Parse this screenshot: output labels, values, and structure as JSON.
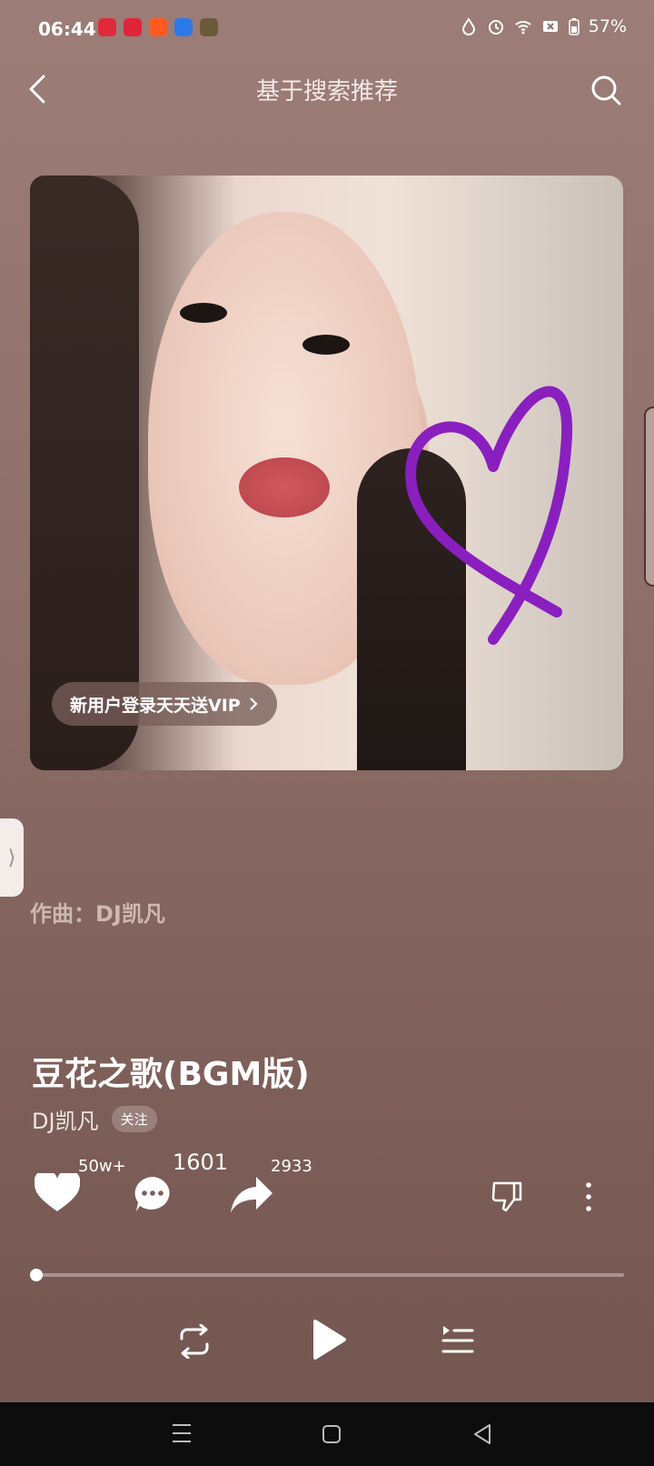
{
  "status_bar": {
    "time": "06:44",
    "battery": "57%",
    "app_icons": [
      "douyin-icon",
      "video-app-icon",
      "kuaishou-icon",
      "browser-icon",
      "game-icon"
    ]
  },
  "header": {
    "title": "基于搜索推荐"
  },
  "cover": {
    "vip_promo": "新用户登录天天送VIP"
  },
  "composer": "作曲：DJ凯凡",
  "song": {
    "title": "豆花之歌(BGM版)",
    "artist": "DJ凯凡",
    "follow_label": "关注"
  },
  "actions": {
    "likes": "50w+",
    "comments": "1601",
    "shares": "2933"
  },
  "player": {
    "progress": 0.0
  },
  "colors": {
    "background": "#8e6f69",
    "heart_doodle": "#8a1fbf"
  }
}
